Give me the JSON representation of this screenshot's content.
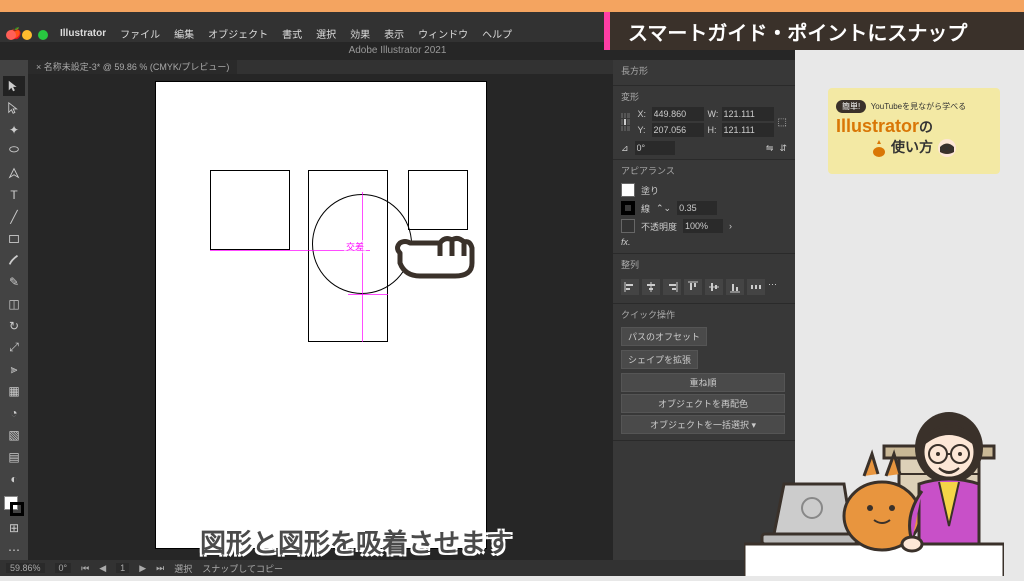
{
  "menubar": {
    "app": "Illustrator",
    "items": [
      "ファイル",
      "編集",
      "オブジェクト",
      "書式",
      "選択",
      "効果",
      "表示",
      "ウィンドウ",
      "ヘルプ"
    ]
  },
  "titlebar": "Adobe Illustrator 2021",
  "docTab": "× 名称未設定-3* @ 59.86 % (CMYK/プレビュー)",
  "smartLabel": "交差",
  "panel": {
    "shapeTitle": "長方形",
    "transformTitle": "変形",
    "x": "449.860",
    "y": "207.056",
    "w": "121.111",
    "h": "121.111",
    "angle": "0°",
    "appearanceTitle": "アピアランス",
    "fill": "塗り",
    "stroke": "線",
    "strokeVal": "0.35",
    "opacity": "不透明度",
    "opacityVal": "100%",
    "alignTitle": "整列",
    "quickTitle": "クイック操作",
    "btnOffset": "パスのオフセット",
    "btnExpand": "シェイプを拡張",
    "btnArrange": "重ね順",
    "btnRecolor": "オブジェクトを再配色",
    "btnSelect": "オブジェクトを一括選択"
  },
  "status": {
    "zoom": "59.86%",
    "angle": "0°",
    "page": "1",
    "tool": "選択",
    "snap": "スナップしてコピー"
  },
  "banner": "スマートガイド・ポイントにスナップ",
  "promo": {
    "badge": "簡単!",
    "tag": "YouTubeを見ながら学べる",
    "brand": "Illustrator",
    "no": "の",
    "sub": "使い方"
  },
  "caption": "図形と図形を吸着させます"
}
